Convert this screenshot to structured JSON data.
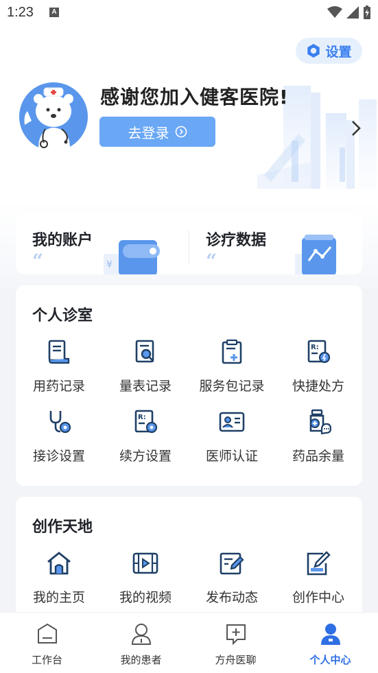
{
  "status_bar": {
    "time": "1:23",
    "notification_letter": "A"
  },
  "header": {
    "settings_label": "设置",
    "welcome_text": "感谢您加入健客医院!",
    "login_label": "去登录"
  },
  "account": {
    "items": [
      {
        "title": "我的账户",
        "quote": "“",
        "icon": "wallet-illustration"
      },
      {
        "title": "诊疗数据",
        "quote": "“",
        "icon": "chart-illustration"
      }
    ]
  },
  "clinic": {
    "title": "个人诊室",
    "items": [
      {
        "label": "用药记录",
        "icon": "medication-record-icon"
      },
      {
        "label": "量表记录",
        "icon": "scale-record-icon"
      },
      {
        "label": "服务包记录",
        "icon": "service-package-icon"
      },
      {
        "label": "快捷处方",
        "icon": "quick-prescription-icon"
      },
      {
        "label": "接诊设置",
        "icon": "stethoscope-settings-icon"
      },
      {
        "label": "续方设置",
        "icon": "renew-prescription-icon"
      },
      {
        "label": "医师认证",
        "icon": "doctor-certification-icon"
      },
      {
        "label": "药品余量",
        "icon": "medicine-stock-icon"
      }
    ]
  },
  "creation": {
    "title": "创作天地",
    "items": [
      {
        "label": "我的主页",
        "icon": "home-icon"
      },
      {
        "label": "我的视频",
        "icon": "video-icon"
      },
      {
        "label": "发布动态",
        "icon": "publish-post-icon"
      },
      {
        "label": "创作中心",
        "icon": "creation-center-icon"
      }
    ]
  },
  "bottom_nav": {
    "items": [
      {
        "label": "工作台",
        "icon": "workbench-icon"
      },
      {
        "label": "我的患者",
        "icon": "patients-icon"
      },
      {
        "label": "方舟医聊",
        "icon": "chat-icon"
      },
      {
        "label": "个人中心",
        "icon": "profile-icon",
        "active": true
      }
    ]
  },
  "colors": {
    "accent": "#3b7ff0",
    "icon": "#1e3f66",
    "active_tab": "#2f6fe4"
  }
}
